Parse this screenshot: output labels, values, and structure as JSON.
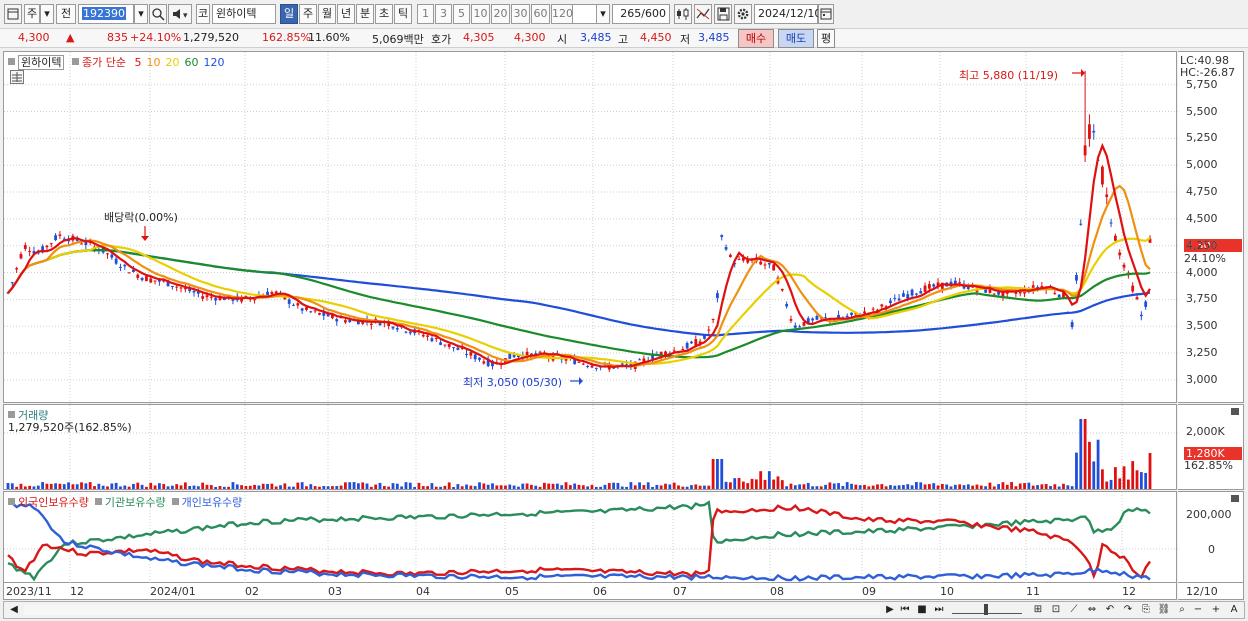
{
  "toolbar": {
    "market": "주",
    "mode": "전",
    "code": "192390",
    "market_type": "코",
    "stock_name": "윈하이텍",
    "periods": [
      "일",
      "주",
      "월",
      "년",
      "분",
      "초",
      "틱"
    ],
    "active_period": "일",
    "intervals": [
      "1",
      "3",
      "5",
      "10",
      "20",
      "30",
      "60",
      "120"
    ],
    "count": "265",
    "count_total": "/600",
    "date": "2024/12/10"
  },
  "info": {
    "price": "4,300",
    "change_arrow": "▲",
    "change": "835",
    "change_pct": "+24.10%",
    "volume": "1,279,520",
    "volume_ratio": "162.85%",
    "turnover": "11.60%",
    "amount": "5,069백만",
    "hoga_label": "호가",
    "hoga_ask": "4,305",
    "hoga_bid": "4,300",
    "open_label": "시",
    "open": "3,485",
    "high_label": "고",
    "high": "4,450",
    "low_label": "저",
    "low": "3,485",
    "buy_button": "매수",
    "sell_button": "매도",
    "eval_button": "평"
  },
  "price_panel": {
    "legend_name": "윈하이텍",
    "legend_type": "종가 단순",
    "ma_periods": [
      "5",
      "10",
      "20",
      "60",
      "120"
    ],
    "ma_colors": [
      "#e01010",
      "#f09010",
      "#e8d000",
      "#1a8c2a",
      "#1f4fd8"
    ],
    "y_ticks": [
      "5,750",
      "5,500",
      "5,250",
      "5,000",
      "4,750",
      "4,500",
      "4,250",
      "4,000",
      "3,750",
      "3,500",
      "3,250",
      "3,000"
    ],
    "lc": "LC:40.98",
    "hc": "HC:-26.87",
    "last_price_tag": "4,300",
    "last_pct": "24.10%",
    "dividend_label": "배당락(0.00%)",
    "high_label": "최고 5,880 (11/19)",
    "low_label": "최저 3,050 (05/30)"
  },
  "volume_panel": {
    "title": "거래량",
    "value": "1,279,520주(162.85%)",
    "y_tick": "2,000K",
    "last_tag": "1,280K",
    "last_pct": "162.85%"
  },
  "flow_panel": {
    "series": [
      "외국인보유수량",
      "기관보유수량",
      "개인보유수량"
    ],
    "colors": [
      "#d81818",
      "#2a8c5a",
      "#2f5fd8"
    ],
    "y_ticks": [
      "200,000",
      "0"
    ]
  },
  "x_axis": {
    "labels": [
      "2023/11",
      "12",
      "2024/01",
      "02",
      "03",
      "04",
      "05",
      "06",
      "07",
      "08",
      "09",
      "10",
      "11",
      "12"
    ],
    "right_label": "12/10"
  }
}
